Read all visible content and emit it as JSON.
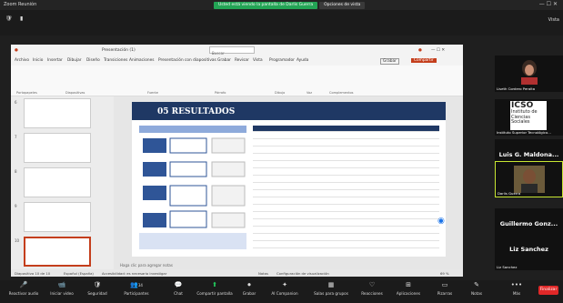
{
  "zoom": {
    "window_title": "Zoom Reunión",
    "share_status": "Usted está viendo la pantalla de Darlis Guerra",
    "share_options": "Opciones de vista",
    "view_label": "Vista",
    "bottom_toolbar": [
      {
        "label": "Reactivar audio",
        "icon": "mic-icon"
      },
      {
        "label": "Iniciar video",
        "icon": "video-icon"
      },
      {
        "label": "Seguridad",
        "icon": "shield-icon"
      },
      {
        "label": "Participantes",
        "icon": "participants-icon",
        "count": "34"
      },
      {
        "label": "Chat",
        "icon": "chat-icon"
      },
      {
        "label": "Compartir pantalla",
        "icon": "share-screen-icon"
      },
      {
        "label": "Grabar",
        "icon": "record-icon"
      },
      {
        "label": "AI Companion",
        "icon": "ai-companion-icon"
      },
      {
        "label": "Salas para grupos",
        "icon": "breakout-icon"
      },
      {
        "label": "Reacciones",
        "icon": "reactions-icon"
      },
      {
        "label": "Aplicaciones",
        "icon": "apps-icon"
      },
      {
        "label": "Pizarras",
        "icon": "whiteboard-icon"
      },
      {
        "label": "Notas",
        "icon": "notes-icon"
      },
      {
        "label": "Más",
        "icon": "more-icon"
      }
    ],
    "end_label": "Finalizar"
  },
  "powerpoint": {
    "doc_title": "Presentación (1)",
    "search_placeholder": "Buscar",
    "tabs": [
      "Archivo",
      "Inicio",
      "Insertar",
      "Dibujar",
      "Diseño",
      "Transiciones",
      "Animaciones",
      "Presentación con diapositivas",
      "Grabar",
      "Revisar",
      "Vista",
      "Programador",
      "Ayuda"
    ],
    "record_btn": "Grabar",
    "share_btn": "Compartir",
    "ribbon_groups": [
      "Portapapeles",
      "Diapositivas",
      "Fuente",
      "Párrafo",
      "Dibujo",
      "Voz",
      "Complementos"
    ],
    "slide_title": "05 RESULTADOS",
    "notes_placeholder": "Haga clic para agregar notas",
    "status_slide": "Diapositiva 10 de 10",
    "status_language": "Español (España)",
    "status_accessibility": "Accesibilidad: es necesario investigar",
    "status_notes": "Notas",
    "status_display": "Configuración de visualización",
    "zoom_level": "69 %"
  },
  "participants": [
    {
      "name": "Liseth Cordero Peralta"
    },
    {
      "name": "Instituto Superior Tecnológico...",
      "logo_text": "ICSO",
      "logo_sub": "Instituto de Ciencias Sociales"
    },
    {
      "name": "Luis G. Maldona...",
      "subname": "Luis G. Maldonado..."
    },
    {
      "name": "Darlis Guerra"
    },
    {
      "name": "Guillermo Gonz...",
      "subname": "Guillermo González"
    },
    {
      "name": "Liz Sanchez",
      "subname": "Liz Sanchez"
    }
  ]
}
